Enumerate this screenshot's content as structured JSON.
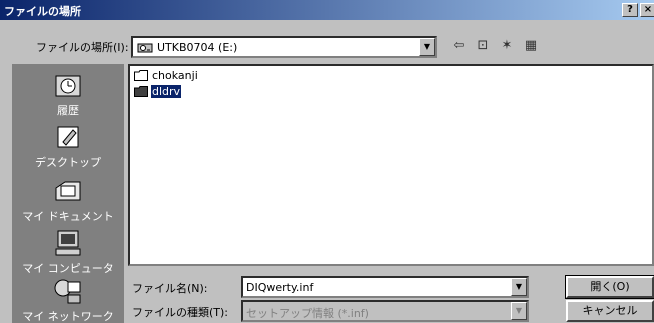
{
  "window": {
    "title": "ファイルの場所",
    "help_label": "?",
    "close_label": "×"
  },
  "lookin": {
    "label": "ファイルの場所(I):",
    "value": "UTKB0704 (E:)"
  },
  "toolbar": {
    "back_icon": "⇦",
    "up_icon": "⊡",
    "newfolder_icon": "✶",
    "view_icon": "▦"
  },
  "places": [
    {
      "label": "履歴",
      "icon": "history-icon"
    },
    {
      "label": "デスクトップ",
      "icon": "desktop-icon"
    },
    {
      "label": "マイ ドキュメント",
      "icon": "my-documents-icon"
    },
    {
      "label": "マイ コンピュータ",
      "icon": "my-computer-icon"
    },
    {
      "label": "マイ ネットワーク",
      "icon": "my-network-icon"
    }
  ],
  "files": [
    {
      "name": "chokanji",
      "selected": false
    },
    {
      "name": "dldrv",
      "selected": true
    }
  ],
  "filename": {
    "label": "ファイル名(N):",
    "value": "DIQwerty.inf"
  },
  "filetype": {
    "label": "ファイルの種類(T):",
    "value": "セットアップ情報 (*.inf)"
  },
  "buttons": {
    "open": "開く(O)",
    "cancel": "キャンセル"
  }
}
